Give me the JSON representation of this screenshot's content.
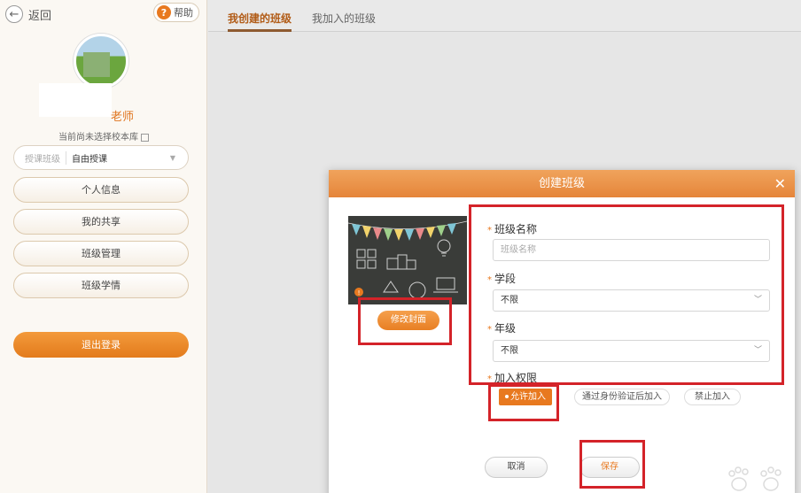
{
  "sidebar": {
    "back_label": "返回",
    "help_label": "帮助",
    "teacher_suffix": "老师",
    "school_note": "当前尚未选择校本库",
    "mode": {
      "label": "授课班级",
      "value": "自由授课"
    },
    "menu": [
      {
        "label": "个人信息"
      },
      {
        "label": "我的共享"
      },
      {
        "label": "班级管理"
      },
      {
        "label": "班级学情"
      }
    ],
    "logout_label": "退出登录"
  },
  "tabs": [
    {
      "label": "我创建的班级",
      "active": true
    },
    {
      "label": "我加入的班级",
      "active": false
    }
  ],
  "dialog": {
    "title": "创建班级",
    "cover_button": "修改封面",
    "fields": {
      "class_name": {
        "label": "班级名称",
        "placeholder": "班级名称",
        "value": ""
      },
      "stage": {
        "label": "学段",
        "value": "不限"
      },
      "grade": {
        "label": "年级",
        "value": "不限"
      },
      "permission": {
        "label": "加入权限"
      }
    },
    "permission_options": [
      {
        "label": "允许加入",
        "selected": true
      },
      {
        "label": "通过身份验证后加入",
        "selected": false
      },
      {
        "label": "禁止加入",
        "selected": false
      }
    ],
    "cancel_label": "取消",
    "save_label": "保存"
  },
  "colors": {
    "accent": "#e8791f",
    "annotation_red": "#d42329",
    "header_gradient_top": "#f0a35c"
  }
}
